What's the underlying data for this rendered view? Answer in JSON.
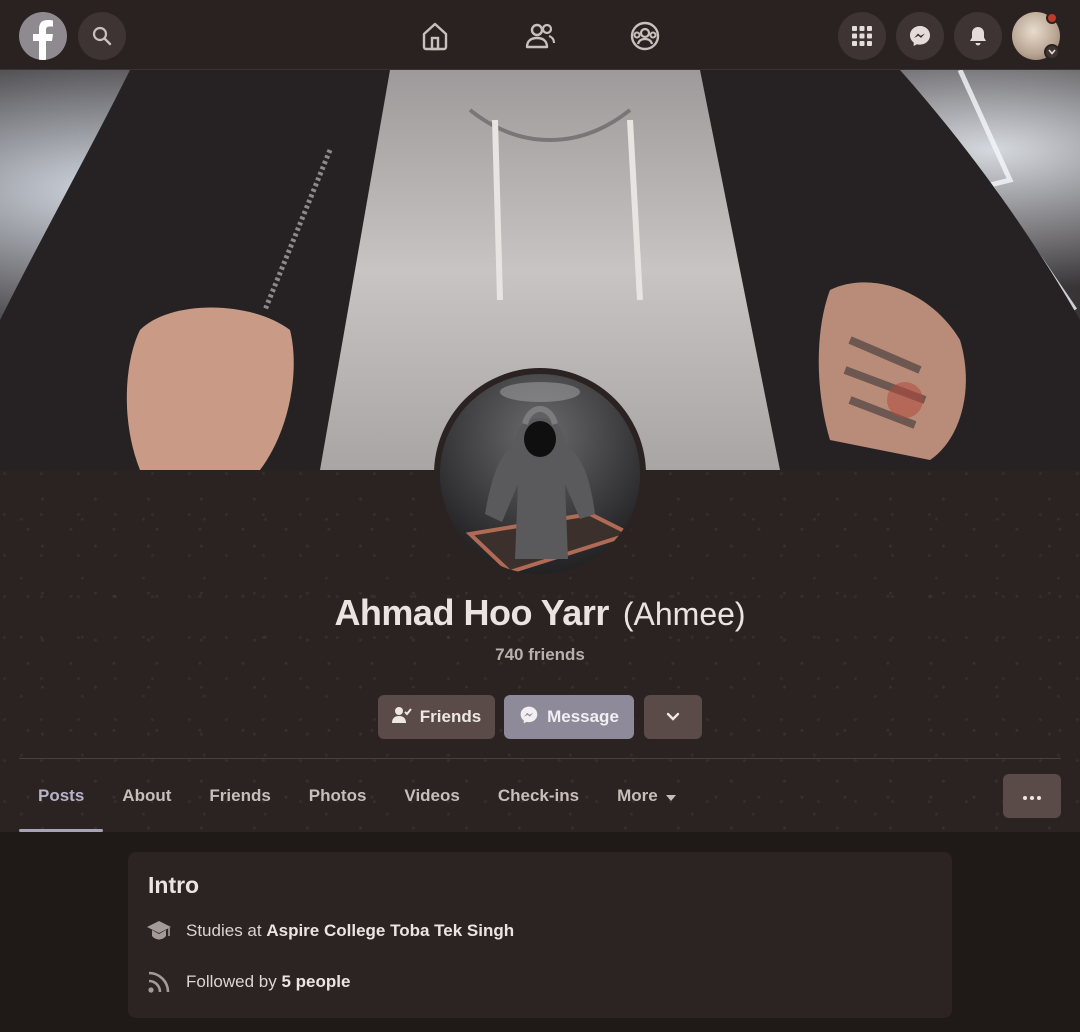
{
  "colors": {
    "background": "#2b2322",
    "message_button": "#8f8a9a",
    "secondary_button": "#5b4b48",
    "active_tab": "#b6b3c8",
    "notification_dot": "#c03a2b"
  },
  "topbar": {
    "logo_icon": "facebook-logo",
    "left_icons": [
      "search-icon"
    ],
    "center_icons": [
      "home-icon",
      "friends-icon",
      "groups-icon"
    ],
    "right_icons": [
      "menu-grid-icon",
      "messenger-icon",
      "notifications-bell-icon",
      "account-avatar"
    ]
  },
  "profile": {
    "name": "Ahmad Hoo Yarr",
    "nickname": "(Ahmee)",
    "friends_count": "740 friends"
  },
  "actions": {
    "friends_label": "Friends",
    "message_label": "Message"
  },
  "tabs": [
    {
      "label": "Posts",
      "active": true
    },
    {
      "label": "About"
    },
    {
      "label": "Friends"
    },
    {
      "label": "Photos"
    },
    {
      "label": "Videos"
    },
    {
      "label": "Check-ins"
    },
    {
      "label": "More"
    }
  ],
  "intro": {
    "title": "Intro",
    "studies_prefix": "Studies at",
    "studies_place": "Aspire College Toba Tek Singh",
    "followed_prefix": "Followed by",
    "followed_count": "5 people"
  }
}
